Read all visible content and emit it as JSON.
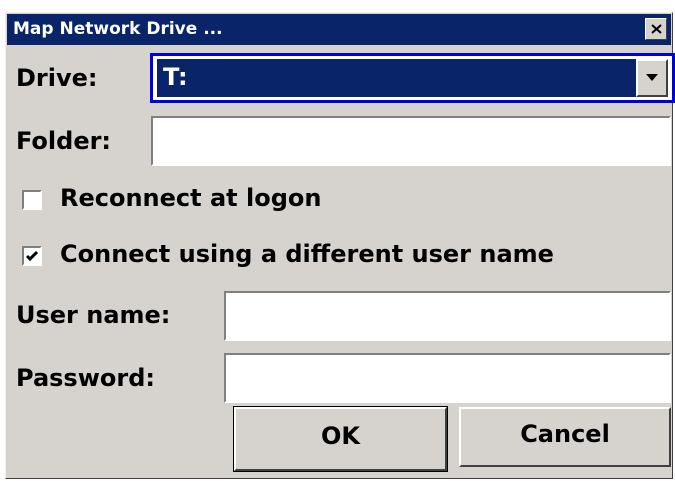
{
  "dialog": {
    "title": "Map Network Drive ...",
    "close_icon": "close-x-icon"
  },
  "drive": {
    "label": "Drive:",
    "value": "T:"
  },
  "folder": {
    "label": "Folder:",
    "value": ""
  },
  "reconnect": {
    "label": "Reconnect at logon",
    "checked": false
  },
  "different_user": {
    "label": "Connect using a different user name",
    "checked": true
  },
  "username": {
    "label": "User name:",
    "value": ""
  },
  "password": {
    "label": "Password:",
    "value": ""
  },
  "buttons": {
    "ok": "OK",
    "cancel": "Cancel"
  },
  "colors": {
    "title_bg": "#0a246a",
    "dialog_bg": "#d6d3ce",
    "focus_border": "#0000dd"
  }
}
